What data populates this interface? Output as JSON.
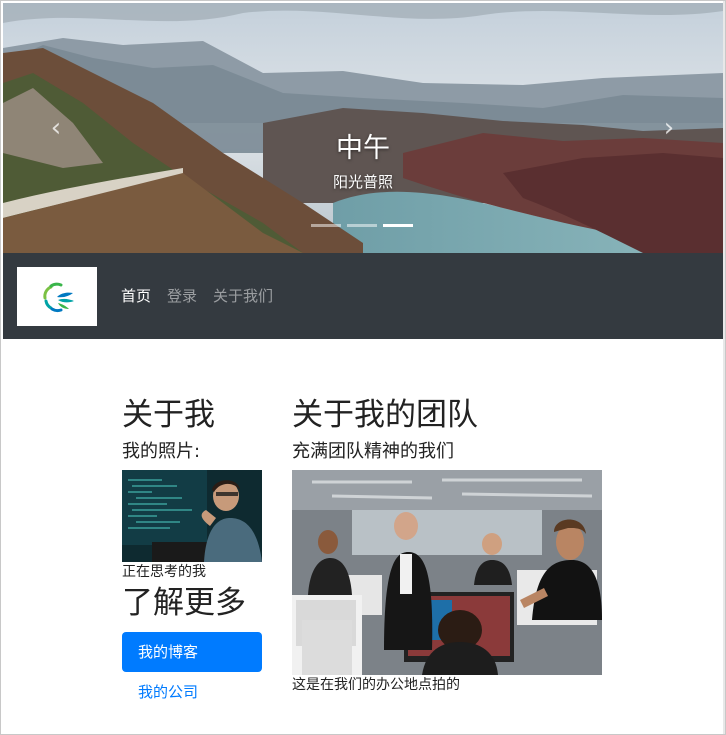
{
  "carousel": {
    "title": "中午",
    "subtitle": "阳光普照",
    "prev_icon": "chevron-left-icon",
    "next_icon": "chevron-right-icon",
    "prev_glyph": "‹",
    "next_glyph": "›",
    "indicator_count": 3,
    "active_indicator": 3
  },
  "navbar": {
    "background": "#343a40",
    "brand_logo": "brand-logo-icon",
    "links": [
      {
        "label": "首页",
        "active": true
      },
      {
        "label": "登录",
        "active": false
      },
      {
        "label": "关于我们",
        "active": false
      }
    ]
  },
  "about_me": {
    "title": "关于我",
    "photo_label": "我的照片:",
    "photo_caption": "正在思考的我"
  },
  "learn_more": {
    "title": "了解更多",
    "links": [
      {
        "label": "我的博客",
        "active": true
      },
      {
        "label": "我的公司",
        "active": false
      }
    ]
  },
  "team": {
    "title": "关于我的团队",
    "subtitle": "充满团队精神的我们",
    "photo_caption": "这是在我们的办公地点拍的"
  },
  "colors": {
    "accent": "#007bff",
    "navbar": "#343a40"
  }
}
